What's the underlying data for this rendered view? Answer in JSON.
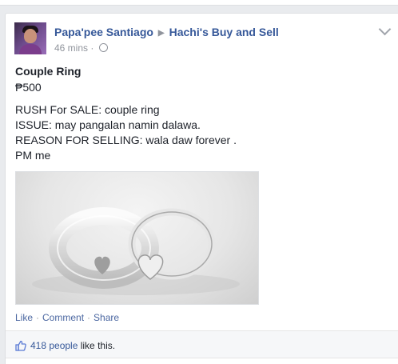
{
  "post": {
    "author": "Papa'pee Santiago",
    "group": "Hachi's Buy and Sell",
    "time": "46 mins",
    "title": "Couple Ring",
    "price": "₱500",
    "lines": [
      "RUSH For SALE: couple ring",
      "ISSUE: may pangalan namin dalawa.",
      "REASON FOR SELLING: wala daw forever .",
      "PM me"
    ]
  },
  "actions": {
    "like": "Like",
    "comment": "Comment",
    "share": "Share"
  },
  "likes": {
    "count_text": "418 people",
    "suffix": " like this."
  },
  "icons": {
    "separator": "chevron-right-icon",
    "privacy": "globe-icon",
    "menu": "chevron-down-icon",
    "like": "thumbs-up-icon"
  },
  "colors": {
    "link": "#365899",
    "meta": "#90949c",
    "page_bg": "#e9ebee"
  }
}
